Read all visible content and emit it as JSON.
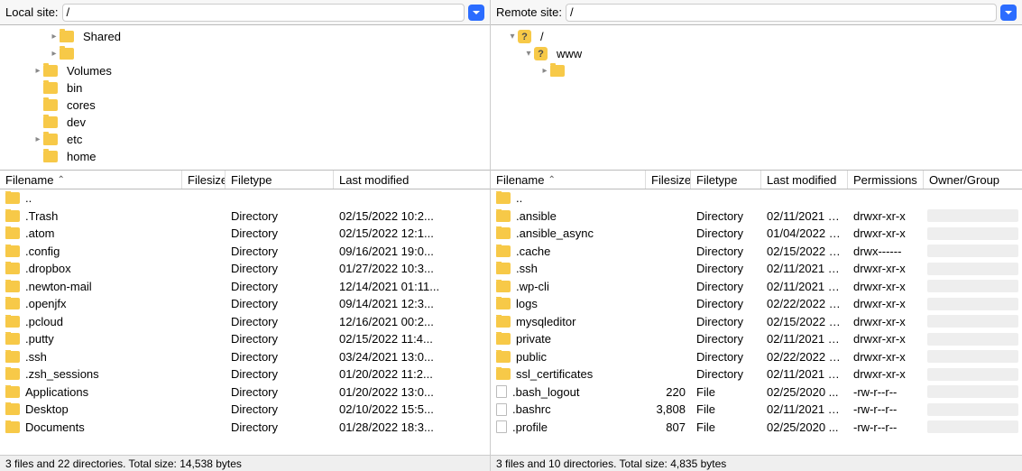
{
  "left": {
    "site_label": "Local site:",
    "site_path": "/",
    "tree": [
      {
        "indent": 2,
        "expander": ">",
        "icon": "folder",
        "label": "Shared",
        "selected": false
      },
      {
        "indent": 2,
        "expander": ">",
        "icon": "folder",
        "label": "          ",
        "selected": true
      },
      {
        "indent": 1,
        "expander": ">",
        "icon": "folder",
        "label": "Volumes",
        "selected": false
      },
      {
        "indent": 1,
        "expander": "",
        "icon": "folder",
        "label": "bin",
        "selected": false
      },
      {
        "indent": 1,
        "expander": "",
        "icon": "folder",
        "label": "cores",
        "selected": false
      },
      {
        "indent": 1,
        "expander": "",
        "icon": "folder",
        "label": "dev",
        "selected": false
      },
      {
        "indent": 1,
        "expander": ">",
        "icon": "folder",
        "label": "etc",
        "selected": false
      },
      {
        "indent": 1,
        "expander": "",
        "icon": "folder",
        "label": "home",
        "selected": false
      }
    ],
    "columns": {
      "name": "Filename",
      "size": "Filesize",
      "type": "Filetype",
      "modified": "Last modified"
    },
    "rows": [
      {
        "name": "..",
        "size": "",
        "type": "",
        "modified": "",
        "icon": "folder"
      },
      {
        "name": ".Trash",
        "size": "",
        "type": "Directory",
        "modified": "02/15/2022 10:2...",
        "icon": "folder"
      },
      {
        "name": ".atom",
        "size": "",
        "type": "Directory",
        "modified": "02/15/2022 12:1...",
        "icon": "folder"
      },
      {
        "name": ".config",
        "size": "",
        "type": "Directory",
        "modified": "09/16/2021 19:0...",
        "icon": "folder"
      },
      {
        "name": ".dropbox",
        "size": "",
        "type": "Directory",
        "modified": "01/27/2022 10:3...",
        "icon": "folder"
      },
      {
        "name": ".newton-mail",
        "size": "",
        "type": "Directory",
        "modified": "12/14/2021 01:11...",
        "icon": "folder"
      },
      {
        "name": ".openjfx",
        "size": "",
        "type": "Directory",
        "modified": "09/14/2021 12:3...",
        "icon": "folder"
      },
      {
        "name": ".pcloud",
        "size": "",
        "type": "Directory",
        "modified": "12/16/2021 00:2...",
        "icon": "folder"
      },
      {
        "name": ".putty",
        "size": "",
        "type": "Directory",
        "modified": "02/15/2022 11:4...",
        "icon": "folder"
      },
      {
        "name": ".ssh",
        "size": "",
        "type": "Directory",
        "modified": "03/24/2021 13:0...",
        "icon": "folder"
      },
      {
        "name": ".zsh_sessions",
        "size": "",
        "type": "Directory",
        "modified": "01/20/2022 11:2...",
        "icon": "folder"
      },
      {
        "name": "Applications",
        "size": "",
        "type": "Directory",
        "modified": "01/20/2022 13:0...",
        "icon": "folder"
      },
      {
        "name": "Desktop",
        "size": "",
        "type": "Directory",
        "modified": "02/10/2022 15:5...",
        "icon": "folder"
      },
      {
        "name": "Documents",
        "size": "",
        "type": "Directory",
        "modified": "01/28/2022 18:3...",
        "icon": "folder"
      }
    ],
    "status": "3 files and 22 directories. Total size: 14,538 bytes"
  },
  "right": {
    "site_label": "Remote site:",
    "site_path": "/",
    "tree": [
      {
        "indent": 0,
        "expander": "v",
        "icon": "q",
        "label": "/",
        "selected": false
      },
      {
        "indent": 1,
        "expander": "v",
        "icon": "q",
        "label": "www",
        "selected": false
      },
      {
        "indent": 2,
        "expander": ">",
        "icon": "folder",
        "label": "                        ",
        "selected": true
      }
    ],
    "columns": {
      "name": "Filename",
      "size": "Filesize",
      "type": "Filetype",
      "modified": "Last modified",
      "permissions": "Permissions",
      "owner": "Owner/Group"
    },
    "rows": [
      {
        "name": "..",
        "size": "",
        "type": "",
        "modified": "",
        "perm": "",
        "icon": "folder"
      },
      {
        "name": ".ansible",
        "size": "",
        "type": "Directory",
        "modified": "02/11/2021 1...",
        "perm": "drwxr-xr-x",
        "icon": "folder"
      },
      {
        "name": ".ansible_async",
        "size": "",
        "type": "Directory",
        "modified": "01/04/2022 1...",
        "perm": "drwxr-xr-x",
        "icon": "folder"
      },
      {
        "name": ".cache",
        "size": "",
        "type": "Directory",
        "modified": "02/15/2022 1...",
        "perm": "drwx------",
        "icon": "folder"
      },
      {
        "name": ".ssh",
        "size": "",
        "type": "Directory",
        "modified": "02/11/2021 1...",
        "perm": "drwxr-xr-x",
        "icon": "folder"
      },
      {
        "name": ".wp-cli",
        "size": "",
        "type": "Directory",
        "modified": "02/11/2021 1...",
        "perm": "drwxr-xr-x",
        "icon": "folder"
      },
      {
        "name": "logs",
        "size": "",
        "type": "Directory",
        "modified": "02/22/2022 1...",
        "perm": "drwxr-xr-x",
        "icon": "folder"
      },
      {
        "name": "mysqleditor",
        "size": "",
        "type": "Directory",
        "modified": "02/15/2022 1...",
        "perm": "drwxr-xr-x",
        "icon": "folder"
      },
      {
        "name": "private",
        "size": "",
        "type": "Directory",
        "modified": "02/11/2021 1...",
        "perm": "drwxr-xr-x",
        "icon": "folder"
      },
      {
        "name": "public",
        "size": "",
        "type": "Directory",
        "modified": "02/22/2022 1...",
        "perm": "drwxr-xr-x",
        "icon": "folder"
      },
      {
        "name": "ssl_certificates",
        "size": "",
        "type": "Directory",
        "modified": "02/11/2021 1...",
        "perm": "drwxr-xr-x",
        "icon": "folder"
      },
      {
        "name": ".bash_logout",
        "size": "220",
        "type": "File",
        "modified": "02/25/2020 ...",
        "perm": "-rw-r--r--",
        "icon": "file"
      },
      {
        "name": ".bashrc",
        "size": "3,808",
        "type": "File",
        "modified": "02/11/2021 1...",
        "perm": "-rw-r--r--",
        "icon": "file"
      },
      {
        "name": ".profile",
        "size": "807",
        "type": "File",
        "modified": "02/25/2020 ...",
        "perm": "-rw-r--r--",
        "icon": "file"
      }
    ],
    "status": "3 files and 10 directories. Total size: 4,835 bytes"
  },
  "sort_arrow": "⌃"
}
